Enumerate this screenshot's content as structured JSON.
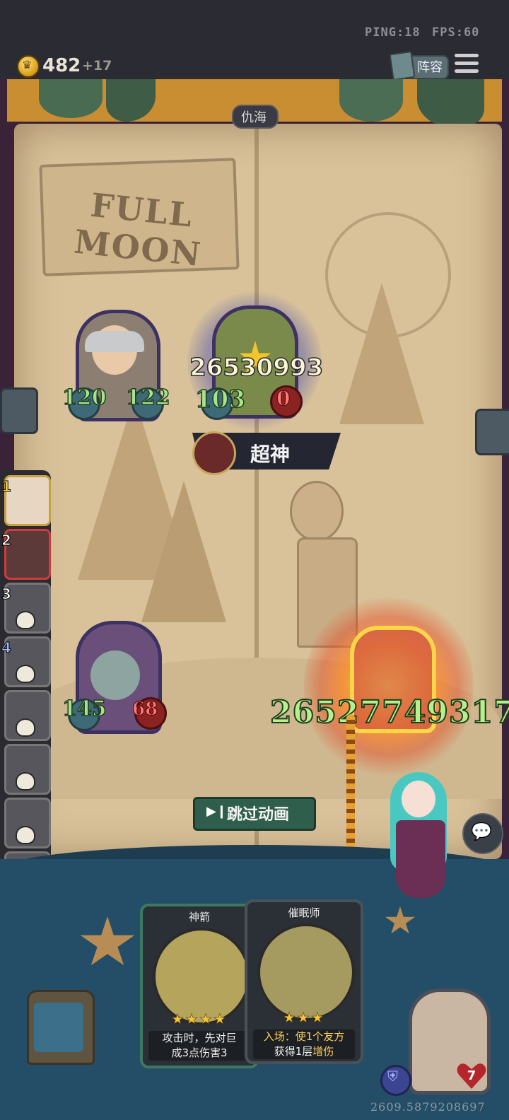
{
  "status": {
    "ping": "PING:18",
    "fps": "FPS:60"
  },
  "resources": {
    "coins": "482",
    "income": "+17"
  },
  "header": {
    "lineup_label": "阵容",
    "opponent_name": "仇海"
  },
  "board": {
    "sign_text": "FULL MOON",
    "banner_text": "超神",
    "skip_label": "跳过动画"
  },
  "player_minion": {
    "attack": "120",
    "health": "122"
  },
  "enemy_minion_top": {
    "damage_number": "26530993",
    "attack": "103",
    "health": "0"
  },
  "player_minion_bottom": {
    "attack": "145",
    "health": "68"
  },
  "attacking_minion": {
    "big_number": "26527749317"
  },
  "history": {
    "slots": [
      {
        "num": "1"
      },
      {
        "num": "2"
      },
      {
        "num": "3"
      },
      {
        "num": "4"
      }
    ]
  },
  "hand": [
    {
      "title": "神箭",
      "stars": "★★★★",
      "desc_line1": "攻击时，先对巨",
      "desc_line2": "成3点伤害3"
    },
    {
      "title": "催眠师",
      "stars": "★★★",
      "desc_line1": "入场：使1个友方",
      "desc_line2": "获得1层",
      "desc_highlight": "增伤"
    }
  ],
  "hero": {
    "health": "7"
  },
  "footer": {
    "coords": "2609.5879208697"
  },
  "colors": {
    "accent_green": "#a7e38b",
    "accent_red": "#ff7a7a",
    "frame_purple": "#3a2339",
    "table_blue": "#244e67",
    "button_green": "#2f5f4c"
  },
  "icons": [
    "coin-icon",
    "book-icon",
    "menu-icon",
    "skull-icon",
    "chat-icon",
    "armor-icon",
    "heart-icon",
    "skip-icon"
  ]
}
